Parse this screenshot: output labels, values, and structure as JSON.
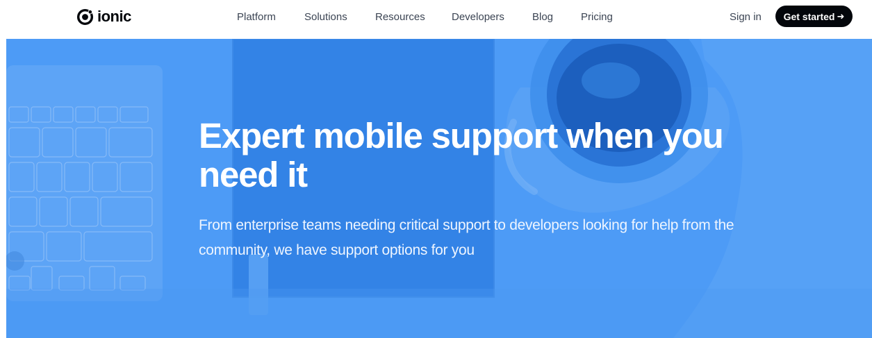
{
  "header": {
    "logo": {
      "text": "ionic",
      "icon": "ionic-logo-icon"
    },
    "nav": [
      {
        "label": "Platform"
      },
      {
        "label": "Solutions"
      },
      {
        "label": "Resources"
      },
      {
        "label": "Developers"
      },
      {
        "label": "Blog"
      },
      {
        "label": "Pricing"
      }
    ],
    "signin_label": "Sign in",
    "cta_label": "Get started",
    "cta_icon": "arrow-right-icon"
  },
  "hero": {
    "title": "Expert mobile support when you need it",
    "subtitle": "From enterprise teams needing critical support to developers looking for help from the community, we have support options for you",
    "background_color": "#4c9af5"
  },
  "colors": {
    "cta_background": "#03060b",
    "nav_text": "#3b4453",
    "hero_text": "#ffffff"
  }
}
